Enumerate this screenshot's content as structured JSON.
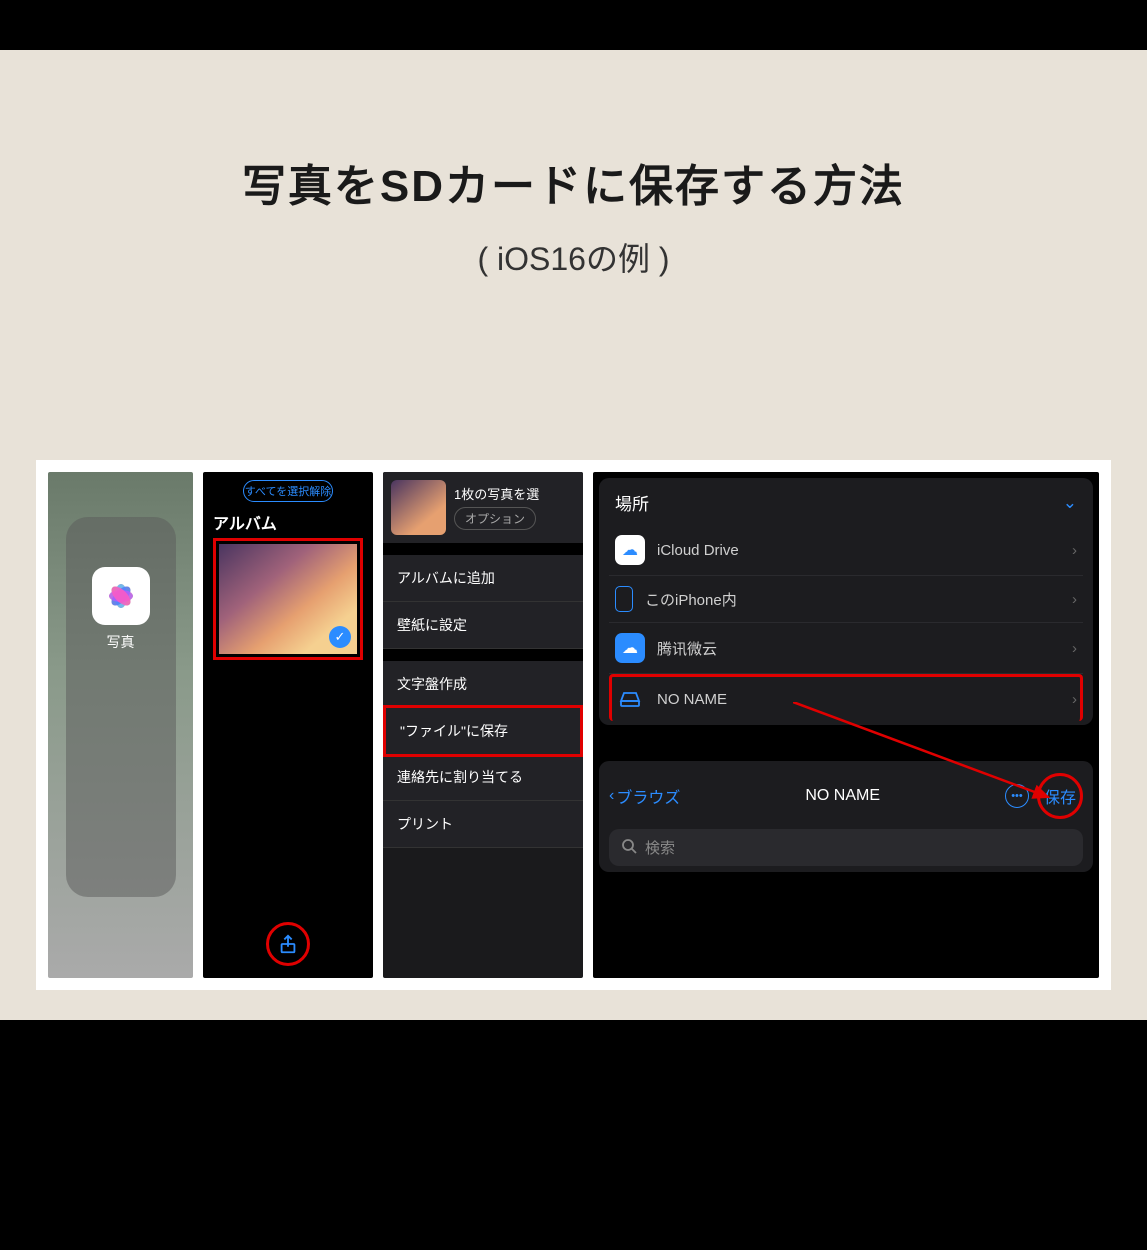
{
  "title": {
    "main": "写真をSDカードに保存する方法",
    "sub": "( iOS16の例 )"
  },
  "panel1": {
    "app_label": "写真"
  },
  "panel2": {
    "deselect_all": "すべてを選択解除",
    "album_label": "アルバム"
  },
  "panel3": {
    "header": "1枚の写真を選",
    "options": "オプション",
    "items": {
      "add_album": "アルバムに追加",
      "wallpaper": "壁紙に設定",
      "watchface": "文字盤作成",
      "save_files": "\"ファイル\"に保存",
      "assign_contact": "連絡先に割り当てる",
      "print": "プリント"
    }
  },
  "panel4": {
    "locations_header": "場所",
    "locations": {
      "icloud": "iCloud Drive",
      "iphone": "このiPhone内",
      "weiyun": "腾讯微云",
      "noname": "NO NAME"
    },
    "browse_back": "ブラウズ",
    "location_title": "NO NAME",
    "save_label": "保存",
    "search_placeholder": "検索"
  }
}
